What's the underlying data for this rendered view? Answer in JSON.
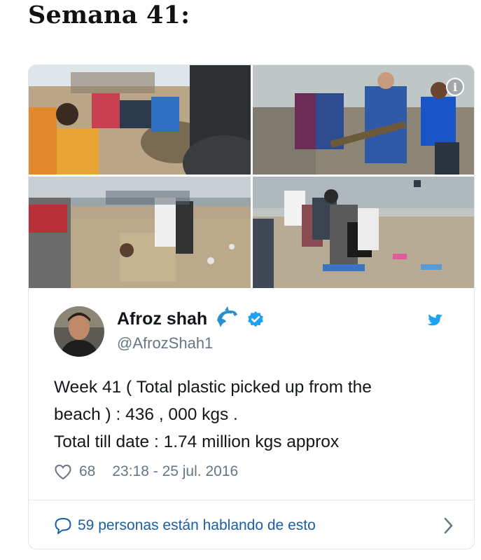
{
  "page": {
    "heading": "Semana 41:"
  },
  "tweet": {
    "author": {
      "name": "Afroz shah",
      "handle": "@AfrozShah1"
    },
    "text_lines": [
      "Week 41 ( Total plastic picked up from the",
      "beach ) : 436 , 000 kgs .",
      "Total till date : 1.74 million kgs approx"
    ],
    "likes": "68",
    "timestamp": "23:18 - 25 jul. 2016",
    "conversation_label": "59 personas están hablando de esto",
    "info_symbol": "i"
  },
  "colors": {
    "twitter_blue": "#1da1f2",
    "link_blue": "#1b5ea8",
    "text_gray": "#657786",
    "border": "#e1e8ed"
  },
  "icons": [
    "info-icon",
    "dolphin-emoji-icon",
    "verified-badge-icon",
    "twitter-bird-icon",
    "heart-icon",
    "speech-bubble-icon",
    "chevron-right-icon"
  ]
}
